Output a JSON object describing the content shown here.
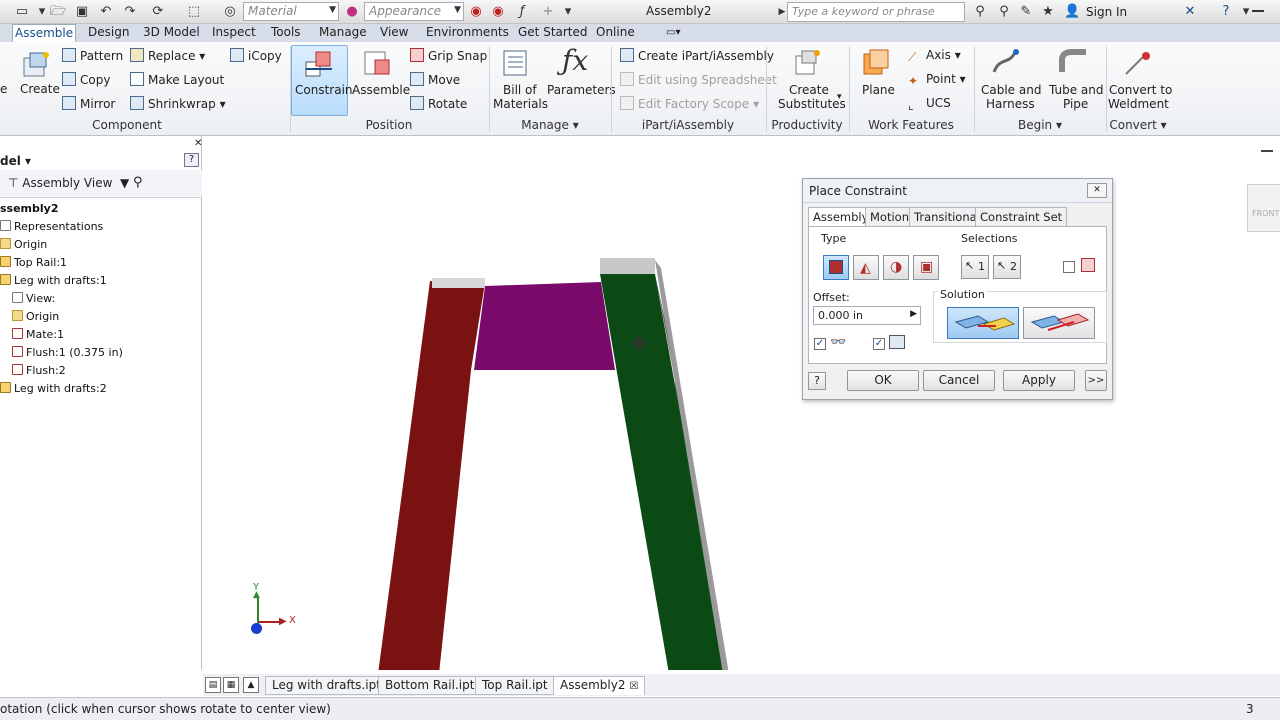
{
  "window": {
    "title": "Assembly2"
  },
  "quick_access": {
    "material_placeholder": "Material",
    "appearance_placeholder": "Appearance",
    "search_placeholder": "Type a keyword or phrase",
    "sign_in": "Sign In"
  },
  "ribbon_tabs": [
    "Assemble",
    "Design",
    "3D Model",
    "Inspect",
    "Tools",
    "Manage",
    "View",
    "Environments",
    "Get Started",
    "Online"
  ],
  "ribbon": {
    "component": {
      "label": "Component",
      "create": "Create",
      "pattern": "Pattern",
      "copy": "Copy",
      "mirror": "Mirror",
      "replace": "Replace",
      "make_layout": "Make Layout",
      "shrinkwrap": "Shrinkwrap",
      "icopy": "iCopy",
      "place_partial": "e"
    },
    "position": {
      "label": "Position",
      "constrain": "Constrain",
      "assemble": "Assemble",
      "grip_snap": "Grip Snap",
      "move": "Move",
      "rotate": "Rotate"
    },
    "manage": {
      "label": "Manage",
      "bom_line1": "Bill of",
      "bom_line2": "Materials",
      "parameters": "Parameters"
    },
    "ipart": {
      "label": "iPart/iAssembly",
      "create": "Create iPart/iAssembly",
      "edit_spreadsheet": "Edit using Spreadsheet",
      "edit_factory": "Edit Factory Scope"
    },
    "productivity": {
      "label": "Productivity",
      "line1": "Create",
      "line2": "Substitutes"
    },
    "work_features": {
      "label": "Work Features",
      "plane": "Plane",
      "axis": "Axis",
      "point": "Point",
      "ucs": "UCS"
    },
    "begin": {
      "label": "Begin",
      "cable_line1": "Cable and",
      "cable_line2": "Harness",
      "tube_line1": "Tube and",
      "tube_line2": "Pipe"
    },
    "convert": {
      "label": "Convert",
      "line1": "Convert to",
      "line2": "Weldment"
    }
  },
  "browser": {
    "title": "del",
    "view_mode": "Assembly View",
    "items": [
      "ssembly2",
      "Representations",
      "Origin",
      "Top Rail:1",
      "Leg with drafts:1",
      "View:",
      "Origin",
      "Mate:1",
      "Flush:1 (0.375 in)",
      "Flush:2",
      "Leg with drafts:2"
    ]
  },
  "axes": {
    "y": "Y",
    "x": "X"
  },
  "viewcube_label": "FRONT",
  "dialog": {
    "title": "Place Constraint",
    "tabs": [
      "Assembly",
      "Motion",
      "Transitional",
      "Constraint Set"
    ],
    "type_label": "Type",
    "selections_label": "Selections",
    "sel1": "1",
    "sel2": "2",
    "offset_label": "Offset:",
    "offset_value": "0.000 in",
    "solution_label": "Solution",
    "ok": "OK",
    "cancel": "Cancel",
    "apply": "Apply",
    "more": ">>"
  },
  "doc_tabs": [
    "Leg with drafts.ipt",
    "Bottom Rail.ipt",
    "Top Rail.ipt",
    "Assembly2"
  ],
  "status": {
    "message": "otation (click when cursor shows rotate to center view)",
    "count": "3"
  },
  "colors": {
    "leg_left": "#7a1212",
    "leg_right": "#0b4a14",
    "rail": "#7a0a6a",
    "accent": "#1a4c8c"
  }
}
